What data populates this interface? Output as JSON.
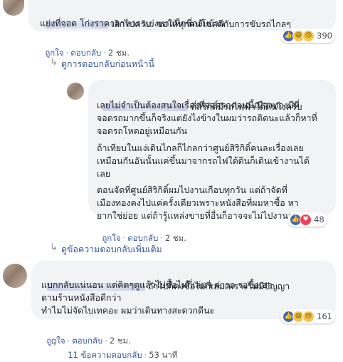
{
  "comments": [
    {
      "lines": [
        "เลิกไปครับ. ขอให้ทุกคนโชคดีกับการขับรถไกลๆ",
        "แย่งที่จอด โก่งราคาอาหาร แย่งหาแท็กซี่กลับบ้าน"
      ],
      "reaction_count": "390",
      "reactions": [
        "like-icon",
        "haha-icon",
        "sad-icon"
      ]
    },
    {
      "paragraphs": [
        [
          "ที่สิริกิติ์มีรถไฟฟ้าใต้ดินไงครับ",
          "เลยไม่จำเป็นต้องสนใจเรื่องที่จอดรถตอนนี้เมืองทองมีที่",
          "จอดรถมากขึ้นก็จริงแต่ยังไงข้างในผมว่ารถติดนะแล้วก็หาที่",
          "จอดรถโหดอยู่เหมือนกัน"
        ],
        [
          "ถ้าเทียบในแง่เดินไกลก็ไกลกว่าศูนย์สิริกิติ์คนละเรื่องเลย",
          "เหมือนกันอันนั้นแค่ขึ้นมาจากรถไฟใต้ดินก็เดินเข้างานได้",
          "เลย"
        ],
        [
          "ตอนจัดที่ศูนย์สิริกิติ์ผมไปงานเกือบทุกวัน แต่ถ้าจัดที่",
          "เมืองทองคงไปแค่ครั้งเดียวเพราะหนังสือที่ผมหาซื้อ หา",
          "ยากใช่ย่อย แต่ถ้ารู้แหล่งขายที่อื่นก็อาจจะไม่ไปงานเลย"
        ]
      ],
      "reaction_count": "48",
      "reactions": [
        "like-icon",
        "love-icon"
      ]
    },
    {
      "lines": [
        "ถ้าไปก็คงซื้อไม่กี่เล่มเพราะไม่มีปัญญา",
        "แบกกลับแน่นอน แต่คิดๆดูแล้วไปซื้อไม่กี่เล่ม+ค่ารถ รอซื้อเอา",
        "ตามร้านหนังสือดีกว่า",
        "ทำไมไม่จัดไบเทคอะ ผมว่าเดินทางสะดวกดีนะ"
      ],
      "reaction_count": "161",
      "reactions": [
        "like-icon",
        "haha-icon",
        "sad-icon"
      ]
    }
  ],
  "actions": {
    "like": "ถูกใจ",
    "reply": "ตอบกลับ",
    "separator": "·",
    "time_2h": "2 ชม.",
    "time_53m": "53 นาที"
  },
  "links": {
    "previous_replies": "ดูการตอบกลับก่อนหน้านี้",
    "more_replies": "ดูข้อความตอบกลับเพิ่มเติม",
    "replies_count": "11 ข้อความตอบกลับ"
  },
  "colors": {
    "link": "#385898",
    "bubble": "#f2f3f5",
    "like": "#4267b2"
  }
}
